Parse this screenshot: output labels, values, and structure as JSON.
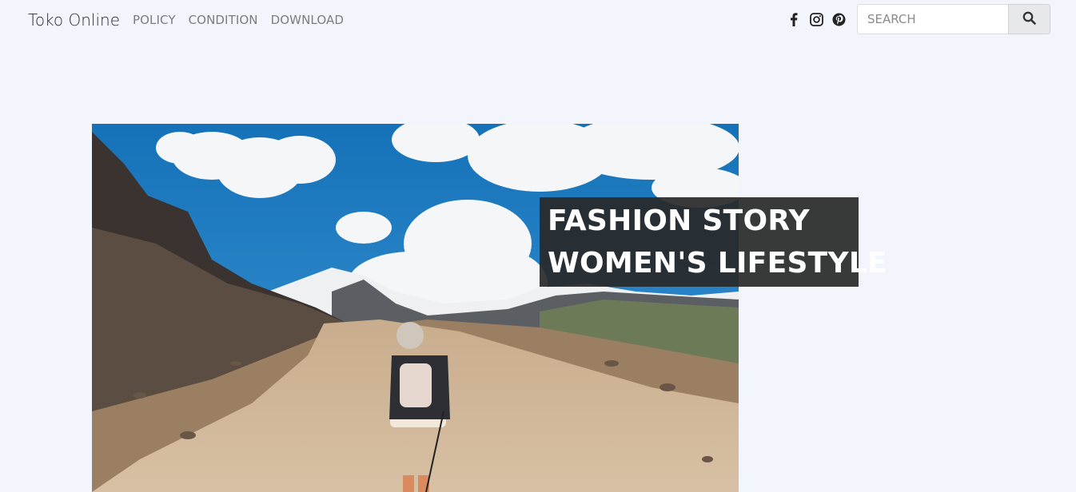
{
  "navbar": {
    "brand": "Toko Online",
    "links": [
      {
        "label": "POLICY"
      },
      {
        "label": "CONDITION"
      },
      {
        "label": "DOWNLOAD"
      }
    ],
    "social": [
      "facebook-icon",
      "instagram-icon",
      "pinterest-icon"
    ],
    "search": {
      "placeholder": "SEARCH",
      "value": "",
      "button_icon": "search-icon"
    }
  },
  "hero": {
    "caption_line1": "FASHION STORY",
    "caption_line2": "WOMEN'S LIFESTYLE",
    "image_alt": "Hiker with backpack walking on mountain dirt road under blue sky"
  }
}
